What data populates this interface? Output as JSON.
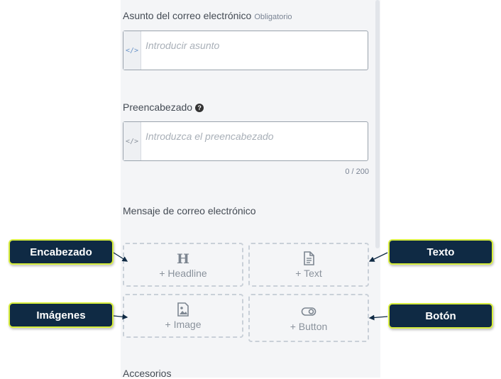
{
  "subject": {
    "label": "Asunto del correo electrónico",
    "required": "Obligatorio",
    "placeholder": "Introducir asunto"
  },
  "preheader": {
    "label": "Preencabezado",
    "placeholder": "Introduzca el preencabezado",
    "counter": "0 / 200"
  },
  "message": {
    "label": "Mensaje de correo electrónico",
    "blocks": {
      "headline": "+ Headline",
      "text": "+ Text",
      "image": "+ Image",
      "button": "+ Button"
    }
  },
  "attachments": {
    "label": "Accesorios"
  },
  "callouts": {
    "headline": "Encabezado",
    "text": "Texto",
    "images": "Imágenes",
    "button": "Botón"
  },
  "colors": {
    "callout_bg": "#0f2a44",
    "callout_border": "#d9ef3d",
    "panel_bg": "#f4f5f7"
  }
}
